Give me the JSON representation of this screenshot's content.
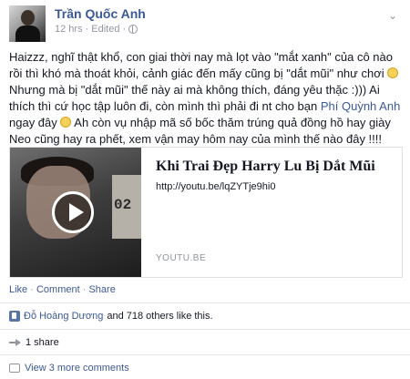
{
  "post": {
    "author": "Trần Quốc Anh",
    "time": "12 hrs",
    "edited": "Edited",
    "sep": "·",
    "body_1": "Haizzz, nghĩ thật khổ, con giai thời nay mà lọt vào \"mắt xanh\" của cô nào rồi thì khó mà thoát khỏi, cảnh giác đến mấy cũng bị \"dắt mũi\" như chơi ",
    "body_2": " Nhưng mà bị \"dắt mũi\" thế này ai mà không thích, đáng yêu thặc :))) Ai thích thì cứ học tập luôn đi, còn mình thì phải đi nt cho bạn ",
    "mention": "Phí Quỳnh Anh",
    "body_3": " ngay đây ",
    "body_4": " Ah còn vụ nhập mã số bốc thăm trúng quả đồng hồ hay giày Neo cũng hay ra phết, xem vận may hôm nay của mình thế nào đây !!!!"
  },
  "link_card": {
    "title": "Khi Trai Đẹp Harry Lu Bị Dắt Mũi",
    "url": "http://youtu.be/lqZYTje9hi0",
    "domain": "YOUTU.BE",
    "thumb_text": "02"
  },
  "actions": {
    "like": "Like",
    "comment": "Comment",
    "share": "Share",
    "sep": "·"
  },
  "likes": {
    "name": "Đỗ Hoàng Dương",
    "rest": "and 718 others like this."
  },
  "shares": "1 share",
  "comments": "View 3 more comments",
  "icons": {
    "menu": "chevron-down-icon",
    "privacy": "globe-icon",
    "video": "play-icon",
    "like": "thumbs-up-icon",
    "share": "share-arrow-icon",
    "comment": "comment-icon"
  },
  "colors": {
    "link": "#3b5998",
    "text": "#141823",
    "meta": "#9197a3"
  }
}
